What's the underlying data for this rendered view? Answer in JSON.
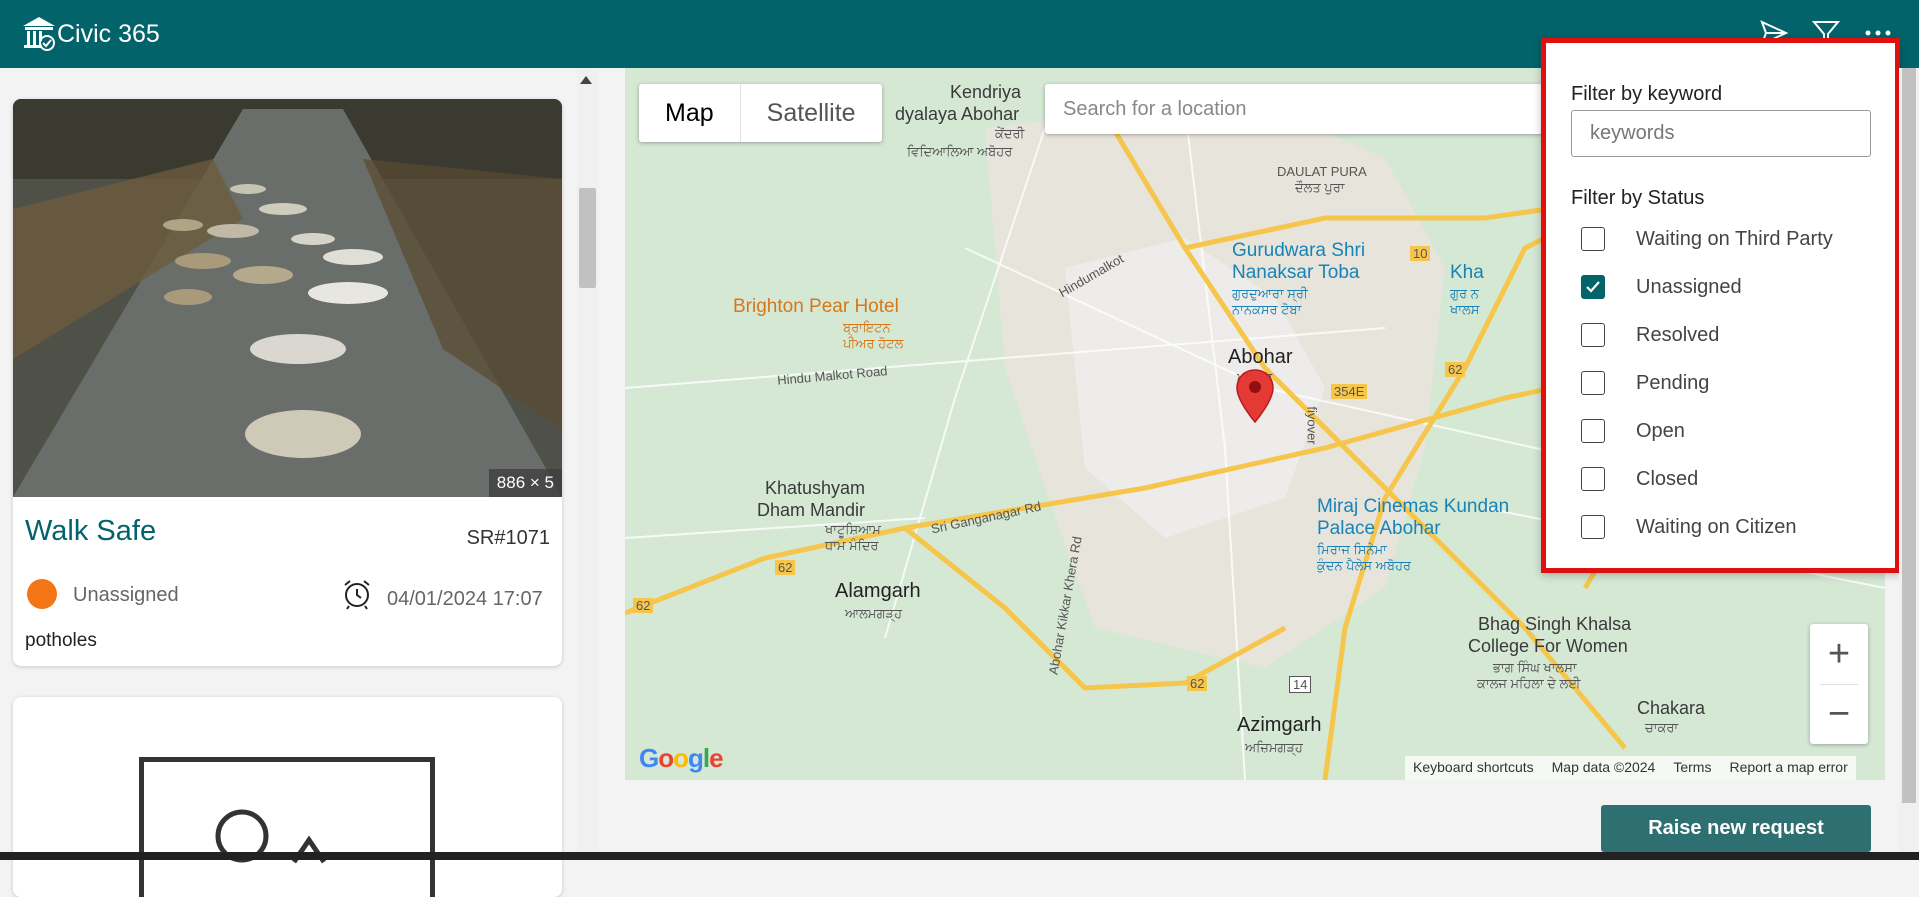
{
  "app": {
    "title": "Civic 365"
  },
  "header": {
    "icons": [
      "send-icon",
      "filter-icon",
      "more-icon"
    ]
  },
  "cards": [
    {
      "image_dimensions": "886 × 5",
      "title": "Walk Safe",
      "sr": "SR#1071",
      "status": "Unassigned",
      "status_color": "#f47516",
      "datetime": "04/01/2024 17:07",
      "category": "potholes"
    }
  ],
  "map": {
    "tabs": {
      "map": "Map",
      "satellite": "Satellite"
    },
    "search_placeholder": "Search for a location",
    "labels": {
      "kendriya": "Kendriya",
      "vidyalaya": "dyalaya Abohar",
      "vidyalaya_pa": "ਕੇਂਦਰੀ",
      "vidyalaya_pa2": "ਵਿਦਿਆਲਿਆ ਅਬੋਹਰ",
      "daulat": "DAULAT PURA",
      "daulat_pa": "ਦੌਲਤ ਪੁਰਾ",
      "gurudwara": "Gurudwara Shri",
      "nanaksar": "Nanaksar Toba",
      "gurudwara_pa": "ਗੁਰਦੁਆਰਾ ਸ੍ਰੀ",
      "nanaksar_pa": "ਨਾਨਕਸਰ ਟੋਬਾ",
      "kha": "Kha",
      "kha_pa": "ਗੁਰ ਨ",
      "kha_pa2": "ਖਾਲਸ",
      "hindumalkot": "Hindumalkot",
      "brighton": "Brighton Pear Hotel",
      "brighton_pa": "ਬ੍ਰਾਇਟਨ",
      "brighton_pa2": "ਪੀਅਰ ਹੋਟਲ",
      "hindu_malkot_road": "Hindu Malkot Road",
      "abohar": "Abohar",
      "abohar_pa": "ਅਬੋਹਰ",
      "fiyover": "fiyover",
      "route_10": "10",
      "route_354e": "354E",
      "route_62a": "62",
      "route_62b": "62",
      "route_62c": "62",
      "route_62d": "62",
      "route_14": "14",
      "khatushyam": "Khatushyam",
      "dham_mandir": "Dham Mandir",
      "khatushyam_pa": "ਖਾਟੂਸ਼ਿਆਮ",
      "dham_pa": "ਧਾਮ ਮੰਦਿਰ",
      "sri_ganganagar": "Sri Ganganagar Rd",
      "miraj": "Miraj Cinemas Kundan",
      "palace": "Palace Abohar",
      "miraj_pa": "ਮਿਰਾਜ ਸਿਨੇਮਾ",
      "miraj_pa2": "ਕੁੰਦਨ ਪੈਲੇਸ ਅਬੋਹਰ",
      "alamgarh": "Alamgarh",
      "alamgarh_pa": "ਆਲਮਗੜ੍ਹ",
      "abohar_kikkar": "Abohar Kikkar Khera Rd",
      "bhag_singh": "Bhag Singh Khalsa",
      "college": "College For Women",
      "bhag_pa": "ਭਾਗ ਸਿੰਘ ਖਾਲਸਾ",
      "college_pa": "ਕਾਲਜ ਮਹਿਲਾ ਦੇ ਲਈ",
      "azimgarh": "Azimgarh",
      "azimgarh_pa": "ਅਜ਼ਿਮਗੜ੍ਹ",
      "chakara": "Chakara",
      "chakara_pa": "ਚਾਕਰਾ"
    },
    "zoom_in": "+",
    "zoom_out": "−",
    "google": "Google",
    "attribution": {
      "keyboard": "Keyboard shortcuts",
      "data": "Map data ©2024",
      "terms": "Terms",
      "report": "Report a map error"
    }
  },
  "actions": {
    "raise_request": "Raise new request"
  },
  "filter": {
    "keyword_heading": "Filter by keyword",
    "keyword_placeholder": "keywords",
    "status_heading": "Filter by Status",
    "statuses": [
      {
        "label": "Waiting on Third Party",
        "checked": false
      },
      {
        "label": "Unassigned",
        "checked": true
      },
      {
        "label": "Resolved",
        "checked": false
      },
      {
        "label": "Pending",
        "checked": false
      },
      {
        "label": "Open",
        "checked": false
      },
      {
        "label": "Closed",
        "checked": false
      },
      {
        "label": "Waiting on Citizen",
        "checked": false
      }
    ]
  }
}
